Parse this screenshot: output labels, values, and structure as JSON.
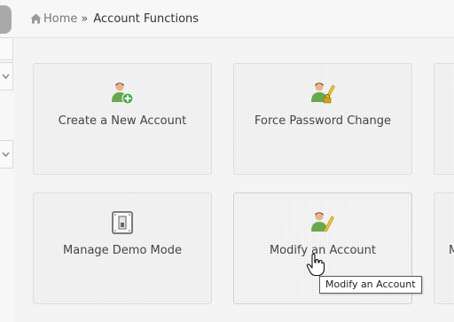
{
  "breadcrumb": {
    "home_label": "Home",
    "separator": "»",
    "current": "Account Functions"
  },
  "tiles": [
    {
      "label": "Create a New Account",
      "icon": "user-add-icon"
    },
    {
      "label": "Force Password Change",
      "icon": "user-lock-pencil-icon"
    },
    {
      "label": "",
      "icon": ""
    },
    {
      "label": "Manage Demo Mode",
      "icon": "door-switch-icon"
    },
    {
      "label": "Modify an Account",
      "icon": "user-pencil-icon"
    },
    {
      "label": "M",
      "icon": ""
    }
  ],
  "tooltip": "Modify an Account",
  "colors": {
    "user_green": "#6aa84f",
    "user_skin": "#e8b48c",
    "pencil_yellow": "#f1c232",
    "add_badge": "#4caf50"
  }
}
